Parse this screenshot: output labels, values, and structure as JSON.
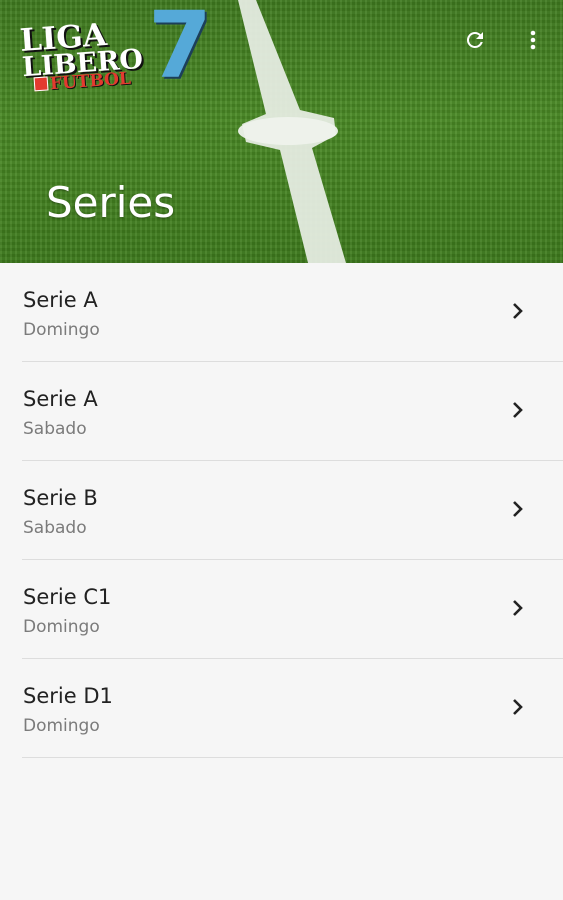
{
  "header": {
    "logo": {
      "line1": "LIGA",
      "line2": "LIBERO",
      "line3": "FUTBOL",
      "number": "7"
    },
    "title": "Series",
    "actions": [
      {
        "name": "refresh-button",
        "icon": "refresh-icon"
      },
      {
        "name": "overflow-menu-button",
        "icon": "more-vert-icon"
      }
    ]
  },
  "series": [
    {
      "title": "Serie A",
      "day": "Domingo"
    },
    {
      "title": "Serie A",
      "day": "Sabado"
    },
    {
      "title": "Serie B",
      "day": "Sabado"
    },
    {
      "title": "Serie C1",
      "day": "Domingo"
    },
    {
      "title": "Serie D1",
      "day": "Domingo"
    }
  ],
  "colors": {
    "background": "#f6f6f6",
    "divider": "#dddddd",
    "title_text": "#222222",
    "subtitle_text": "#7b7b7b",
    "logo_blue": "#55a9d8",
    "logo_red": "#e33a2f"
  }
}
